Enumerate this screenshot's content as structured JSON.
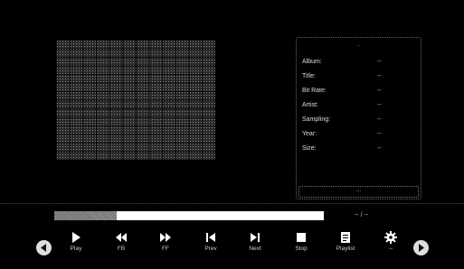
{
  "info_panel": {
    "header": "..",
    "fields": [
      {
        "key": "Album:",
        "value": "--"
      },
      {
        "key": "Title:",
        "value": "--"
      },
      {
        "key": "Bit Rate:",
        "value": "--"
      },
      {
        "key": "Artist:",
        "value": "--"
      },
      {
        "key": "Sampling:",
        "value": "--"
      },
      {
        "key": "Year:",
        "value": "--"
      },
      {
        "key": "Size:",
        "value": "--"
      }
    ],
    "footer_text": "..."
  },
  "playback": {
    "progress_fraction": 0.23,
    "time_text": "-- / --"
  },
  "controls": [
    {
      "label": "Play",
      "icon": "play-icon"
    },
    {
      "label": "FB",
      "icon": "fast-backward-icon"
    },
    {
      "label": "FF",
      "icon": "fast-forward-icon"
    },
    {
      "label": "Prev",
      "icon": "previous-icon"
    },
    {
      "label": "Next",
      "icon": "next-icon"
    },
    {
      "label": "Stop",
      "icon": "stop-icon"
    },
    {
      "label": "Playlist",
      "icon": "playlist-icon"
    },
    {
      "label": "--",
      "icon": "settings-icon"
    }
  ],
  "colors": {
    "background": "#000000",
    "progress_track": "#ffffff",
    "icon": "#ffffff"
  }
}
